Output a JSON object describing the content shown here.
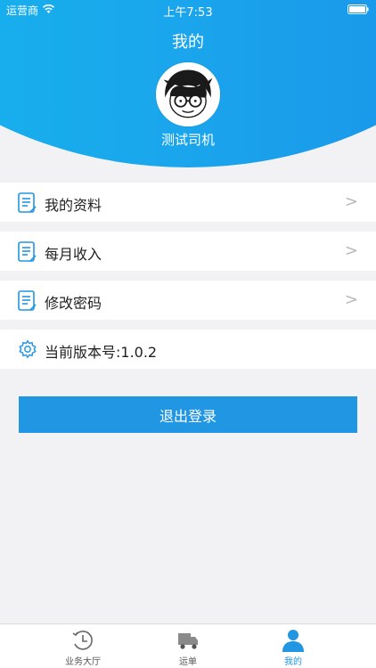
{
  "status_bar": {
    "carrier": "运营商",
    "time": "上午7:53"
  },
  "header": {
    "title": "我的",
    "username": "测试司机"
  },
  "menu": [
    {
      "label": "我的资料",
      "icon": "document-icon",
      "chevron": ">"
    },
    {
      "label": "每月收入",
      "icon": "document-icon",
      "chevron": ">"
    },
    {
      "label": "修改密码",
      "icon": "document-icon",
      "chevron": ">"
    },
    {
      "label": "当前版本号:1.0.2",
      "icon": "gear-icon"
    }
  ],
  "logout_label": "退出登录",
  "tabbar": [
    {
      "label": "业务大厅",
      "icon": "clock-icon",
      "active": false
    },
    {
      "label": "运单",
      "icon": "truck-icon",
      "active": false
    },
    {
      "label": "我的",
      "icon": "person-icon",
      "active": true
    }
  ],
  "colors": {
    "accent": "#2196e3",
    "header_gradient_start": "#14b6ee",
    "header_gradient_end": "#1b8fe9"
  }
}
